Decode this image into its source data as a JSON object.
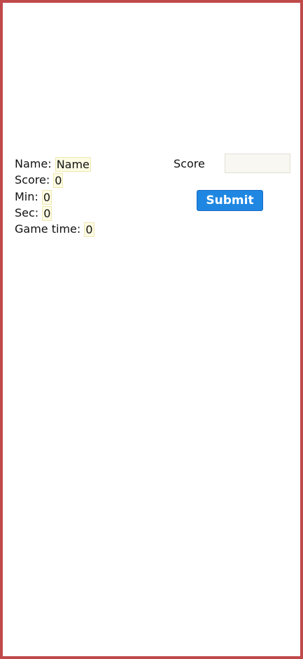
{
  "stats": {
    "name_label": "Name:",
    "name_value": "Name",
    "score_label": "Score:",
    "score_value": "0",
    "min_label": "Min:",
    "min_value": "0",
    "sec_label": "Sec:",
    "sec_value": "0",
    "game_time_label": "Game time:",
    "game_time_value": "0"
  },
  "form": {
    "score_label": "Score",
    "score_input_value": "",
    "submit_label": "Submit"
  },
  "colors": {
    "frame_border": "#c0494a",
    "submit_button": "#1f87e2",
    "value_highlight": "#fdfbe3"
  }
}
